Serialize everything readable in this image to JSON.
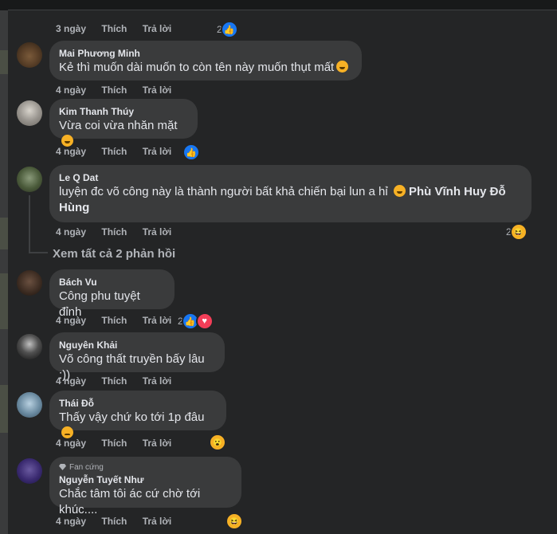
{
  "first_actions": {
    "time": "3 ngày",
    "like": "Thích",
    "reply": "Trả lời",
    "react_count": "2"
  },
  "comments": [
    {
      "name": "Mai Phương Minh",
      "text": "Kẻ thì muốn dài muốn to còn tên này muốn thụt mất",
      "emoji": "rolling-laughing",
      "time": "4 ngày",
      "like": "Thích",
      "reply": "Trả lời",
      "react_count": ""
    },
    {
      "name": "Kim Thanh Thúy",
      "text": "Vừa coi vừa nhăn mặt",
      "emoji": "rolling-laughing",
      "time": "4 ngày",
      "like": "Thích",
      "reply": "Trả lời",
      "react_count": ""
    },
    {
      "name": "Le Q Dat",
      "text_line1": "luyện đc võ công này là thành người bất khả chiến bại lun a hỉ",
      "mention_part1": "Phù Vĩnh Huy Đỗ",
      "mention_part2": "Hùng",
      "emoji": "grin",
      "time": "4 ngày",
      "like": "Thích",
      "reply": "Trả lời",
      "react_count": "2"
    },
    {
      "name": "Bách Vu",
      "text": "Công phu tuyệt đỉnh",
      "time": "4 ngày",
      "like": "Thích",
      "reply": "Trả lời",
      "react_count": "2"
    },
    {
      "name": "Nguyên Khải",
      "text": "Võ công thất truyền bấy lâu :))",
      "time": "4 ngày",
      "like": "Thích",
      "reply": "Trả lời",
      "react_count": ""
    },
    {
      "name": "Thái Đỗ",
      "text": "Thấy vậy chứ ko tới 1p đâu",
      "emoji": "disappointed",
      "time": "4 ngày",
      "like": "Thích",
      "reply": "Trả lời",
      "react_count": ""
    },
    {
      "name": "Nguyễn Tuyết Như",
      "badge": "Fan cứng",
      "text": "Chắc tâm tôi ác cứ chờ tới khúc....",
      "time": "4 ngày",
      "like": "Thích",
      "reply": "Trả lời",
      "react_count": ""
    }
  ],
  "view_replies": "Xem tất cả 2 phản hồi",
  "colors": {
    "panel": "#242526",
    "bubble": "#3a3b3c",
    "like": "#1877f2",
    "love": "#f33e58",
    "haha": "#f7b125"
  }
}
